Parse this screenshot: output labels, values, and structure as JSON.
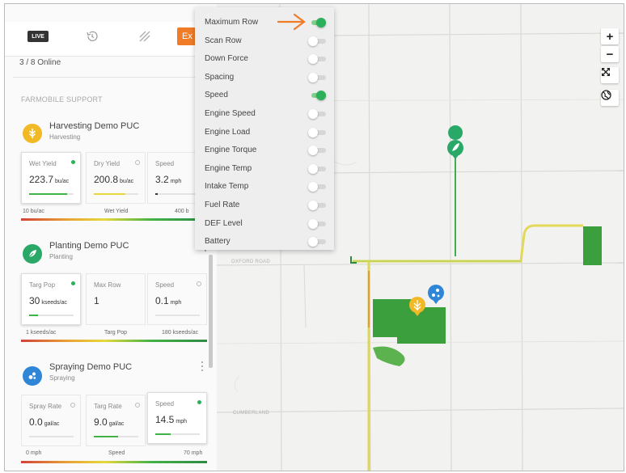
{
  "tabs": {
    "live_label": "LIVE",
    "export_label": "Ex"
  },
  "online_status": "3 / 8 Online",
  "section_title": "FARMOBILE SUPPORT",
  "devices": [
    {
      "name": "Harvesting Demo PUC",
      "type": "Harvesting",
      "icon": "wheat-icon",
      "color": "#f2b927",
      "cards": [
        {
          "label": "Wet Yield",
          "value": "223.7",
          "unit": "bu/ac",
          "active": true,
          "bar_fraction": 0.85,
          "bar_color": "#43b246"
        },
        {
          "label": "Dry Yield",
          "value": "200.8",
          "unit": "bu/ac",
          "active": false,
          "bar_fraction": 0.7,
          "bar_color": "#e6d83c"
        },
        {
          "label": "Speed",
          "value": "3.2",
          "unit": "mph",
          "active": false,
          "bar_fraction": 0.05,
          "bar_color": "#333333"
        }
      ],
      "legend": {
        "min": "10 bu/ac",
        "mid": "Wet Yield",
        "max": "400 b"
      }
    },
    {
      "name": "Planting Demo PUC",
      "type": "Planting",
      "icon": "leaf-icon",
      "color": "#2aa868",
      "cards": [
        {
          "label": "Targ Pop",
          "value": "30",
          "unit": "kseeds/ac",
          "active": true,
          "bar_fraction": 0.2,
          "bar_color": "#43b246"
        },
        {
          "label": "Max Row",
          "value": "1",
          "unit": "",
          "active": false,
          "bar_fraction": 0,
          "bar_color": "#43b246"
        },
        {
          "label": "Speed",
          "value": "0.1",
          "unit": "mph",
          "active": false,
          "bar_fraction": 0,
          "bar_color": "#333333"
        }
      ],
      "legend": {
        "min": "1 kseeds/ac",
        "mid": "Targ Pop",
        "max": "180 kseeds/ac"
      }
    },
    {
      "name": "Spraying Demo PUC",
      "type": "Spraying",
      "icon": "droplets-icon",
      "color": "#2f86d6",
      "cards": [
        {
          "label": "Spray Rate",
          "value": "0.0",
          "unit": "gal/ac",
          "active": false,
          "bar_fraction": 0,
          "bar_color": "#43b246"
        },
        {
          "label": "Targ Rate",
          "value": "9.0",
          "unit": "gal/ac",
          "active": false,
          "bar_fraction": 0.55,
          "bar_color": "#43b246"
        },
        {
          "label": "Speed",
          "value": "14.5",
          "unit": "mph",
          "active": true,
          "bar_fraction": 0.35,
          "bar_color": "#43b246"
        }
      ],
      "legend": {
        "min": "0 mph",
        "mid": "Speed",
        "max": "70 mph"
      }
    }
  ],
  "menu": {
    "items": [
      {
        "label": "Maximum Row",
        "on": true
      },
      {
        "label": "Scan Row",
        "on": false
      },
      {
        "label": "Down Force",
        "on": false
      },
      {
        "label": "Spacing",
        "on": false
      },
      {
        "label": "Speed",
        "on": true
      },
      {
        "label": "Engine Speed",
        "on": false
      },
      {
        "label": "Engine Load",
        "on": false
      },
      {
        "label": "Engine Torque",
        "on": false
      },
      {
        "label": "Engine Temp",
        "on": false
      },
      {
        "label": "Intake Temp",
        "on": false
      },
      {
        "label": "Fuel Rate",
        "on": false
      },
      {
        "label": "DEF Level",
        "on": false
      },
      {
        "label": "Battery",
        "on": false
      }
    ]
  },
  "map": {
    "labels": {
      "oxford_road": "OXFORD ROAD",
      "cumberland": "CUMBERLAND"
    },
    "zoom_in": "+",
    "zoom_out": "−"
  },
  "colors": {
    "accent": "#f07c28",
    "green": "#2db05a"
  }
}
